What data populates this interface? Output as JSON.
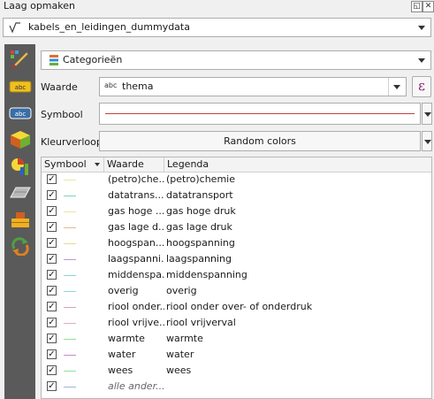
{
  "window": {
    "title": "Laag opmaken"
  },
  "layer": {
    "name": "kabels_en_leidingen_dummydata"
  },
  "renderer": {
    "selected": "Categorieën"
  },
  "form": {
    "waarde_label": "Waarde",
    "waarde_type": "abc",
    "waarde_value": "thema",
    "symbool_label": "Symbool",
    "kleurverloop_label": "Kleurverloop",
    "kleurverloop_value": "Random colors",
    "expression_symbol": "ε"
  },
  "sidebar": {
    "items": [
      "label-abc-icon",
      "label-abc-icon-2",
      "3d-cube-icon",
      "diagram-icon",
      "metadata-icon",
      "fields-icon",
      "actions-icon"
    ]
  },
  "table": {
    "headers": {
      "symbol": "Symbool",
      "value": "Waarde",
      "legend": "Legenda"
    },
    "rows": [
      {
        "checked": true,
        "color": "#e6e8a0",
        "value": "(petro)che...",
        "legend": "(petro)chemie"
      },
      {
        "checked": true,
        "color": "#7fd1bf",
        "value": "datatrans...",
        "legend": "datatransport"
      },
      {
        "checked": true,
        "color": "#e8e6a0",
        "value": "gas hoge ...",
        "legend": "gas hoge druk"
      },
      {
        "checked": true,
        "color": "#e8b890",
        "value": "gas lage d...",
        "legend": "gas lage druk"
      },
      {
        "checked": true,
        "color": "#e8d890",
        "value": "hoogspan...",
        "legend": "hoogspanning"
      },
      {
        "checked": true,
        "color": "#b59ae0",
        "value": "laagspanni...",
        "legend": "laagspanning"
      },
      {
        "checked": true,
        "color": "#8ad8d0",
        "value": "middenspa...",
        "legend": "middenspanning"
      },
      {
        "checked": true,
        "color": "#8ad8d0",
        "value": "overig",
        "legend": "overig"
      },
      {
        "checked": true,
        "color": "#e0a0b8",
        "value": "riool onder...",
        "legend": "riool onder over- of onderdruk"
      },
      {
        "checked": true,
        "color": "#e0b0b8",
        "value": "riool vrijve...",
        "legend": "riool vrijverval"
      },
      {
        "checked": true,
        "color": "#90e090",
        "value": "warmte",
        "legend": "warmte"
      },
      {
        "checked": true,
        "color": "#c888d0",
        "value": "water",
        "legend": "water"
      },
      {
        "checked": true,
        "color": "#90e0a0",
        "value": "wees",
        "legend": "wees"
      },
      {
        "checked": true,
        "color": "#a0b0e0",
        "value": "alle ander...",
        "legend": "",
        "italic": true
      }
    ]
  }
}
